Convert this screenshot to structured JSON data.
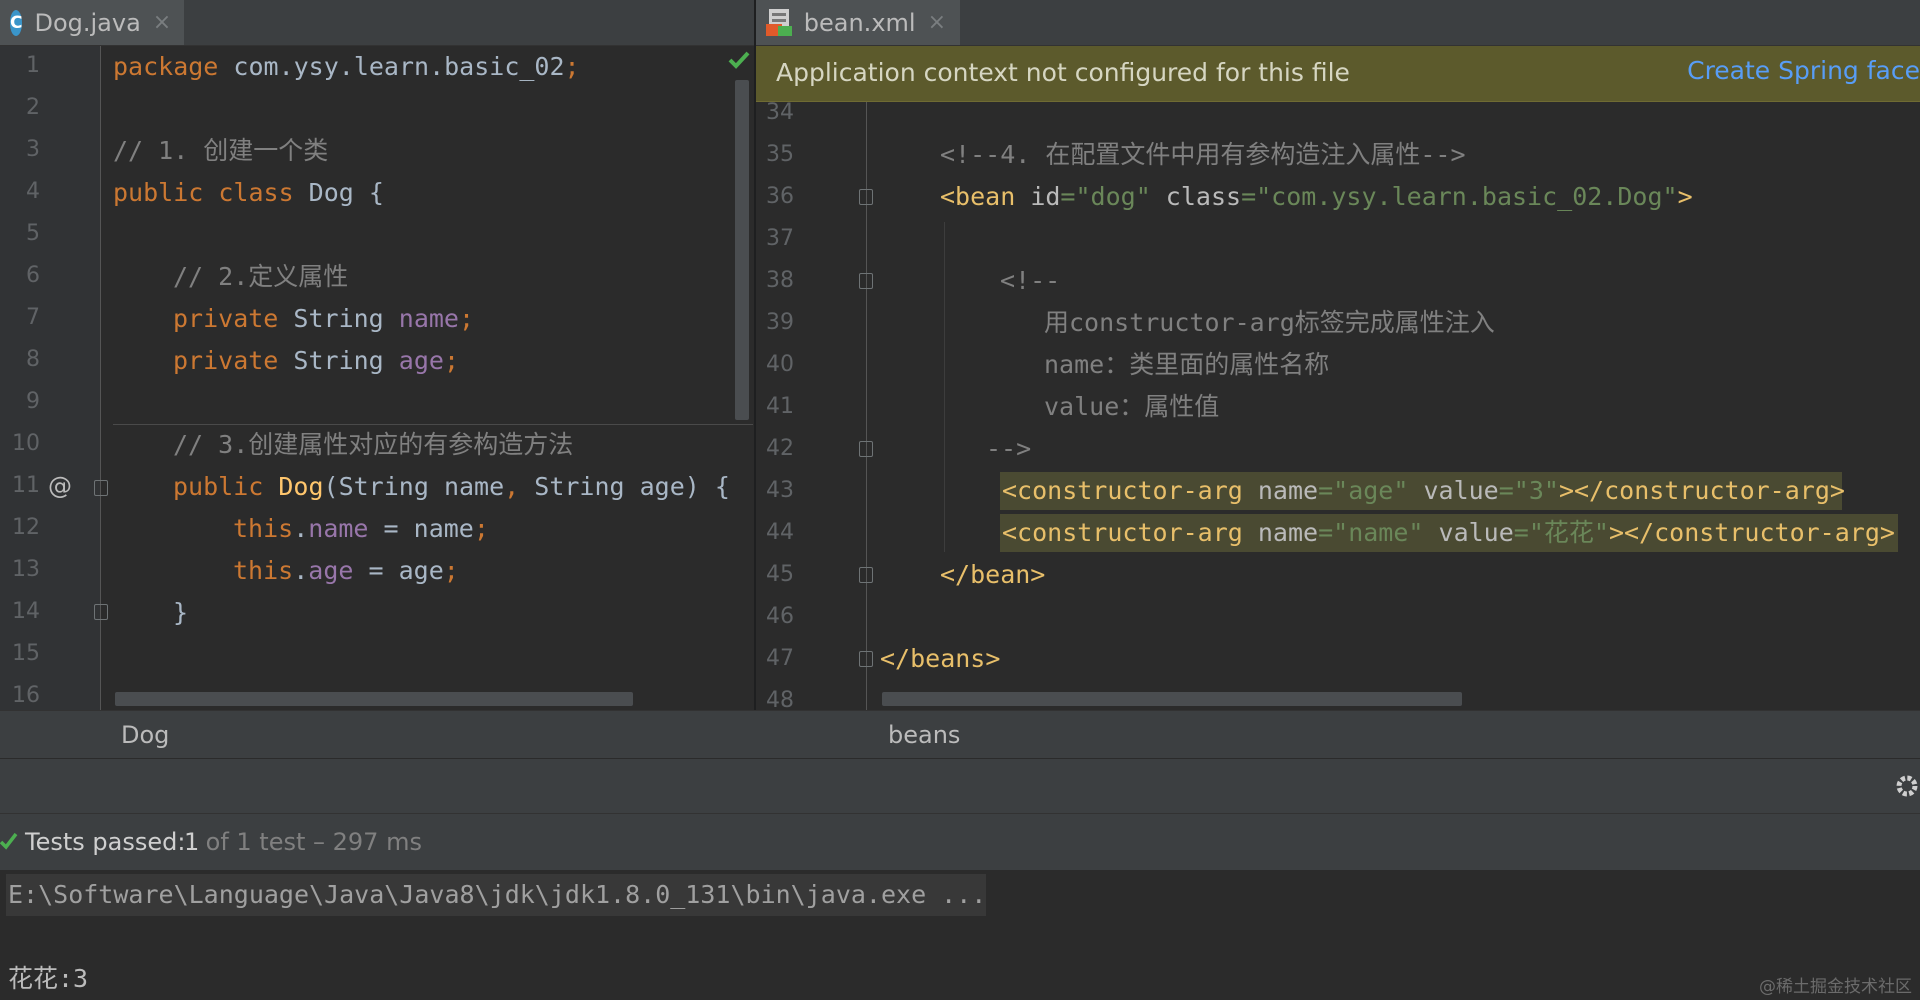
{
  "left_editor": {
    "tab": {
      "icon": "class-c-icon",
      "label": "Dog.java",
      "close": "×"
    },
    "line_numbers": [
      "1",
      "2",
      "3",
      "4",
      "5",
      "6",
      "7",
      "8",
      "9",
      "10",
      "11",
      "12",
      "13",
      "14",
      "15",
      "16"
    ],
    "lines": {
      "l1": {
        "kw": "package",
        "rest": " com.ysy.learn.basic_02",
        "semi": ";"
      },
      "l3": "// 1. 创建一个类",
      "l4": {
        "kw": "public class",
        "rest": " Dog {"
      },
      "l6": "// 2.定义属性",
      "l7": {
        "kw": "private",
        "type": " String ",
        "field": "name",
        "semi": ";"
      },
      "l8": {
        "kw": "private",
        "type": " String ",
        "field": "age",
        "semi": ";"
      },
      "l10": "// 3.创建属性对应的有参构造方法",
      "l11": {
        "kw": "public",
        "fn": " Dog",
        "p1": "(String name",
        "comma": ",",
        "p2": " String age) {"
      },
      "l11_annotation": "@",
      "l12": {
        "kw": "this",
        "dot": ".",
        "field": "name",
        "rest": " = name",
        "semi": ";"
      },
      "l13": {
        "kw": "this",
        "dot": ".",
        "field": "age",
        "rest": " = age",
        "semi": ";"
      },
      "l14": "}"
    },
    "breadcrumb": "Dog",
    "status_icon": "check-icon"
  },
  "right_editor": {
    "tab": {
      "icon": "xml-file-icon",
      "label": "bean.xml",
      "close": "×"
    },
    "banner": {
      "text": "Application context not configured for this file",
      "link": "Create Spring face"
    },
    "line_numbers": [
      "34",
      "35",
      "36",
      "37",
      "38",
      "39",
      "40",
      "41",
      "42",
      "43",
      "44",
      "45",
      "46",
      "47",
      "48"
    ],
    "lines": {
      "l35": "<!--4. 在配置文件中用有参构造注入属性-->",
      "l36": {
        "open": "<bean",
        "a1": " id",
        "eq1": "=",
        "v1": "\"dog\"",
        "a2": " class",
        "eq2": "=",
        "v2": "\"com.ysy.learn.basic_02.Dog\"",
        "close": ">"
      },
      "l38": "<!--",
      "l39": "用constructor-arg标签完成属性注入",
      "l40": "name：类里面的属性名称",
      "l41": "value：属性值",
      "l42": "-->",
      "l43": {
        "open": "<constructor-arg",
        "a1": " name",
        "eq1": "=",
        "v1": "\"age\"",
        "a2": " value",
        "eq2": "=",
        "v2": "\"3\"",
        "close": "></constructor-arg>"
      },
      "l44": {
        "open": "<constructor-arg",
        "a1": " name",
        "eq1": "=",
        "v1": "\"name\"",
        "a2": " value",
        "eq2": "=",
        "v2": "\"花花\"",
        "close": "></constructor-arg>"
      },
      "l45": "</bean>",
      "l47": "</beans>"
    },
    "breadcrumb": "beans"
  },
  "run_panel": {
    "status": {
      "icon": "check-icon",
      "label": "Tests passed: ",
      "count": "1",
      "rest": " of 1 test – 297 ms"
    },
    "console": [
      "E:\\Software\\Language\\Java\\Java8\\jdk\\jdk1.8.0_131\\bin\\java.exe ...",
      "花花:3"
    ],
    "settings_icon": "gear-icon",
    "watermark": "@稀土掘金技术社区"
  },
  "colors": {
    "keyword": "#cc7832",
    "field": "#9876aa",
    "comment": "#808080",
    "string": "#6a8759",
    "tag": "#e8bf6a",
    "banner": "#5c5a2c",
    "link": "#589df6"
  }
}
